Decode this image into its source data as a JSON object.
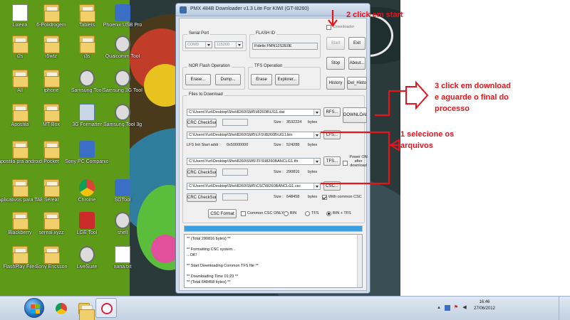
{
  "desktop": {
    "icons": [
      {
        "label": "Lixeira",
        "kind": "app-doc"
      },
      {
        "label": "6-Polidrogem",
        "kind": "folder"
      },
      {
        "label": "Tablets",
        "kind": "folder"
      },
      {
        "label": "Phoenix USB Pro",
        "kind": "app-blue"
      },
      {
        "label": "i2s",
        "kind": "folder"
      },
      {
        "label": "i5wtz",
        "kind": "folder"
      },
      {
        "label": "i3s",
        "kind": "folder"
      },
      {
        "label": "Qualcomm Tool",
        "kind": "app-gear"
      },
      {
        "label": "All",
        "kind": "folder"
      },
      {
        "label": "iphone",
        "kind": "folder"
      },
      {
        "label": "Samsung Tool",
        "kind": "app-gear"
      },
      {
        "label": "Samsung 3G Tool",
        "kind": "app-gear"
      },
      {
        "label": "Apostila",
        "kind": "folder"
      },
      {
        "label": "MT Box",
        "kind": "folder"
      },
      {
        "label": "3G Formatter",
        "kind": "app-pc"
      },
      {
        "label": "Samsung Tool 3g",
        "kind": "app-gear"
      },
      {
        "label": "apostila pra android",
        "kind": "folder"
      },
      {
        "label": "Pocket",
        "kind": "folder"
      },
      {
        "label": "Sony PC Companion 2.1",
        "kind": "app-blue"
      },
      {
        "label": "",
        "kind": "none"
      },
      {
        "label": "Aplicativos para TABLETS",
        "kind": "folder"
      },
      {
        "label": "Sereal",
        "kind": "folder"
      },
      {
        "label": "Chrome",
        "kind": "app-chrome"
      },
      {
        "label": "SGTool",
        "kind": "app-blue"
      },
      {
        "label": "Blackberry",
        "kind": "folder"
      },
      {
        "label": "sereal xyzz",
        "kind": "folder"
      },
      {
        "label": "LGE Tool",
        "kind": "app-red"
      },
      {
        "label": "shell",
        "kind": "app-gear"
      },
      {
        "label": "FlashPlay Files",
        "kind": "folder"
      },
      {
        "label": "Sony Ericsson",
        "kind": "folder"
      },
      {
        "label": "LiveSuite",
        "kind": "app-gear"
      },
      {
        "label": "nana.txt",
        "kind": "app-doc"
      }
    ]
  },
  "window": {
    "title": "PMX 484B Downloader v1.3 Lite For KIWI (GT-I8260)",
    "downloader_label": "Downloader",
    "port_group_label": "Serial Port",
    "port_value": "COM9",
    "baud_value": "115200",
    "flash_id_group_label": "FLASH ID",
    "flash_id_value": "Fidelix FMN12S2E0E",
    "nor_group_label": "NOR Flash Operation",
    "erase_label": "Erase...",
    "dump_label": "Dump...",
    "tfs_group_label": "TFS Operation",
    "tfs_erase_label": "Erase",
    "explorer_label": "Explorer...",
    "start_label": "Start",
    "exit_label": "Exit",
    "stop_label": "Stop",
    "about_label": "About...",
    "history_label": "History",
    "del_history_label": "Del_History",
    "files_group_label": "Files to Download",
    "rfs_path": "C:\\Users\\Yuri\\Desktop\\Sfw\\i8260\\SW5\\I8260B\\UG1.dat",
    "rfs_button": "RFS...",
    "download_label": "DOWNLOAD",
    "crc_label": "CRC CheckSum",
    "size_label": "Size :",
    "rfs_size": "3532224",
    "bytes_label": "bytes",
    "lfs_path": "C:\\Users\\Yuri\\Desktop\\Sfw\\i8260\\SW5\\LFS\\I8260B\\UG1.bin",
    "lfs_button": "LFS...",
    "lfs_start_label": "LFS Init Start addr :",
    "lfs_start_value": "0x50000000",
    "lfs_size": "524288",
    "tfs_path": "C:\\Users\\Yuri\\Desktop\\Sfw\\i8260\\SW5\\TFS\\I8260BANCLG1.tfs",
    "tfs_button": "TFS...",
    "poweron_label": "Power ON after download",
    "tfs_size": "290816",
    "csc_path": "C:\\Users\\Yuri\\Desktop\\Sfw\\i8260\\SW5\\CSC\\I8260BANCLG1.csc",
    "csc_button": "CSC...",
    "csc_size": "648458",
    "with_common_csc_label": "With common CSC",
    "csc_format_label": "CSC Format",
    "common_csc_only_label": "Common CSC ONLY",
    "bin_label": "BIN",
    "tfs_radio_label": "TFS",
    "bin_tfs_label": "BIN + TFS",
    "progress": 1.0,
    "log": [
      "** (Total 290816 bytes) **",
      "",
      "** Formatting CSC system...",
      "...OK!",
      "",
      "** Start Downloading Common TFS file **",
      "",
      "** Downloading Time 01:23 **",
      "** (Total 648458 bytes) **"
    ]
  },
  "annotations": {
    "step2": "2 click em start",
    "step3_line1": "3 click em download",
    "step3_line2": "e aguarde o final do",
    "step3_line3": "processo",
    "step1_line1": "1 selecione os",
    "step1_line2": "arquivos",
    "color": "#e8141b"
  },
  "taskbar": {
    "clock_time": "16:46",
    "clock_date": "27/06/2012"
  }
}
